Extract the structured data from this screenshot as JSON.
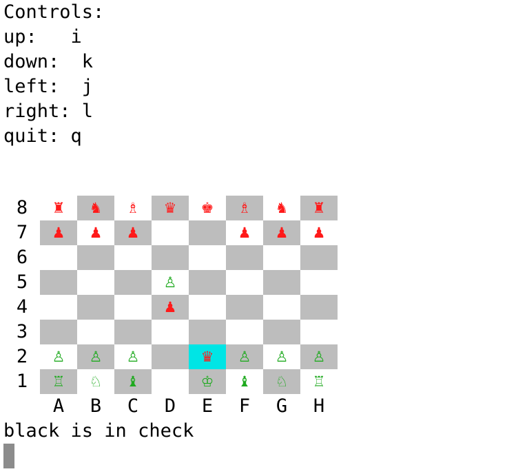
{
  "controls": {
    "heading": "Controls:",
    "lines": [
      "up:   i",
      "down:  k",
      "left:  j",
      "right: l",
      "quit: q"
    ]
  },
  "board": {
    "ranks": [
      "8",
      "7",
      "6",
      "5",
      "4",
      "3",
      "2",
      "1"
    ],
    "files": [
      "A",
      "B",
      "C",
      "D",
      "E",
      "F",
      "G",
      "H"
    ],
    "selected": "E2",
    "colors": {
      "light": "#ffffff",
      "dark": "#bdbdbd",
      "selected": "#00e5e5",
      "red": "#ff1a1a",
      "green": "#1faa1f"
    },
    "rows": [
      [
        {
          "glyph": "♜",
          "side": "red",
          "name": "rook"
        },
        {
          "glyph": "♞",
          "side": "red",
          "name": "knight"
        },
        {
          "glyph": "♗",
          "side": "red",
          "name": "bishop"
        },
        {
          "glyph": "♛",
          "side": "red",
          "name": "queen"
        },
        {
          "glyph": "♚",
          "side": "red",
          "name": "king"
        },
        {
          "glyph": "♗",
          "side": "red",
          "name": "bishop"
        },
        {
          "glyph": "♞",
          "side": "red",
          "name": "knight"
        },
        {
          "glyph": "♜",
          "side": "red",
          "name": "rook"
        }
      ],
      [
        {
          "glyph": "♟",
          "side": "red",
          "name": "pawn"
        },
        {
          "glyph": "♟",
          "side": "red",
          "name": "pawn"
        },
        {
          "glyph": "♟",
          "side": "red",
          "name": "pawn"
        },
        null,
        null,
        {
          "glyph": "♟",
          "side": "red",
          "name": "pawn"
        },
        {
          "glyph": "♟",
          "side": "red",
          "name": "pawn"
        },
        {
          "glyph": "♟",
          "side": "red",
          "name": "pawn"
        }
      ],
      [
        null,
        null,
        null,
        null,
        null,
        null,
        null,
        null
      ],
      [
        null,
        null,
        null,
        {
          "glyph": "♙",
          "side": "green",
          "name": "pawn"
        },
        null,
        null,
        null,
        null
      ],
      [
        null,
        null,
        null,
        {
          "glyph": "♟",
          "side": "red",
          "name": "pawn"
        },
        null,
        null,
        null,
        null
      ],
      [
        null,
        null,
        null,
        null,
        null,
        null,
        null,
        null
      ],
      [
        {
          "glyph": "♙",
          "side": "green",
          "name": "pawn"
        },
        {
          "glyph": "♙",
          "side": "green",
          "name": "pawn"
        },
        {
          "glyph": "♙",
          "side": "green",
          "name": "pawn"
        },
        null,
        {
          "glyph": "♛",
          "side": "red",
          "name": "queen"
        },
        {
          "glyph": "♙",
          "side": "green",
          "name": "pawn"
        },
        {
          "glyph": "♙",
          "side": "green",
          "name": "pawn"
        },
        {
          "glyph": "♙",
          "side": "green",
          "name": "pawn"
        }
      ],
      [
        {
          "glyph": "♖",
          "side": "green",
          "name": "rook"
        },
        {
          "glyph": "♘",
          "side": "green",
          "name": "knight"
        },
        {
          "glyph": "♝",
          "side": "green",
          "name": "bishop"
        },
        null,
        {
          "glyph": "♔",
          "side": "green",
          "name": "king"
        },
        {
          "glyph": "♝",
          "side": "green",
          "name": "bishop"
        },
        {
          "glyph": "♘",
          "side": "green",
          "name": "knight"
        },
        {
          "glyph": "♖",
          "side": "green",
          "name": "rook"
        }
      ]
    ]
  },
  "status": "black is in check"
}
